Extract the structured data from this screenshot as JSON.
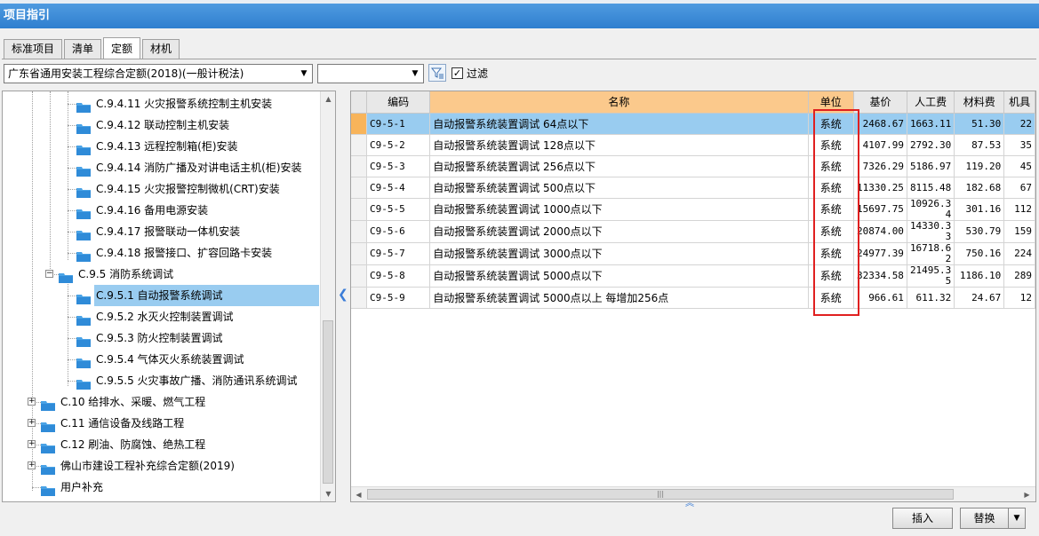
{
  "window": {
    "title": "项目指引"
  },
  "tabs": [
    {
      "label": "标准项目",
      "active": false
    },
    {
      "label": "清单",
      "active": false
    },
    {
      "label": "定额",
      "active": true
    },
    {
      "label": "材机",
      "active": false
    }
  ],
  "filter": {
    "quota_library": "广东省通用安装工程综合定额(2018)(一般计税法)",
    "secondary_combo": "",
    "filter_checked": true,
    "filter_label": "过滤"
  },
  "tree": {
    "items": [
      {
        "label": "C.9.4.11 火灾报警系统控制主机安装",
        "selected": false
      },
      {
        "label": "C.9.4.12 联动控制主机安装",
        "selected": false
      },
      {
        "label": "C.9.4.13 远程控制箱(柜)安装",
        "selected": false
      },
      {
        "label": "C.9.4.14 消防广播及对讲电话主机(柜)安装",
        "selected": false
      },
      {
        "label": "C.9.4.15 火灾报警控制微机(CRT)安装",
        "selected": false
      },
      {
        "label": "C.9.4.16 备用电源安装",
        "selected": false
      },
      {
        "label": "C.9.4.17 报警联动一体机安装",
        "selected": false
      },
      {
        "label": "C.9.4.18 报警接口、扩容回路卡安装",
        "selected": false
      },
      {
        "label": "C.9.5 消防系统调试",
        "selected": false,
        "expander": "−"
      },
      {
        "label": "C.9.5.1 自动报警系统调试",
        "selected": true
      },
      {
        "label": "C.9.5.2 水灭火控制装置调试",
        "selected": false
      },
      {
        "label": "C.9.5.3 防火控制装置调试",
        "selected": false
      },
      {
        "label": "C.9.5.4 气体灭火系统装置调试",
        "selected": false
      },
      {
        "label": "C.9.5.5 火灾事故广播、消防通讯系统调试",
        "selected": false
      },
      {
        "label": "C.10 给排水、采暖、燃气工程",
        "selected": false,
        "expander": "+"
      },
      {
        "label": "C.11 通信设备及线路工程",
        "selected": false,
        "expander": "+"
      },
      {
        "label": "C.12 刷油、防腐蚀、绝热工程",
        "selected": false,
        "expander": "+"
      },
      {
        "label": "佛山市建设工程补充综合定额(2019)",
        "selected": false,
        "expander": "+"
      },
      {
        "label": "用户补充",
        "selected": false
      }
    ]
  },
  "grid": {
    "columns": [
      "编码",
      "名称",
      "单位",
      "基价",
      "人工费",
      "材料费",
      "机具"
    ],
    "rows": [
      {
        "code": "C9-5-1",
        "name": "自动报警系统装置调试 64点以下",
        "unit": "系统",
        "base": "2468.67",
        "labor": "1663.11",
        "material": "51.30",
        "machine": "22",
        "selected": true
      },
      {
        "code": "C9-5-2",
        "name": "自动报警系统装置调试 128点以下",
        "unit": "系统",
        "base": "4107.99",
        "labor": "2792.30",
        "material": "87.53",
        "machine": "35",
        "selected": false
      },
      {
        "code": "C9-5-3",
        "name": "自动报警系统装置调试 256点以下",
        "unit": "系统",
        "base": "7326.29",
        "labor": "5186.97",
        "material": "119.20",
        "machine": "45",
        "selected": false
      },
      {
        "code": "C9-5-4",
        "name": "自动报警系统装置调试 500点以下",
        "unit": "系统",
        "base": "11330.25",
        "labor": "8115.48",
        "material": "182.68",
        "machine": "67",
        "selected": false
      },
      {
        "code": "C9-5-5",
        "name": "自动报警系统装置调试 1000点以下",
        "unit": "系统",
        "base": "15697.75",
        "labor": "10926.34",
        "material": "301.16",
        "machine": "112",
        "selected": false
      },
      {
        "code": "C9-5-6",
        "name": "自动报警系统装置调试 2000点以下",
        "unit": "系统",
        "base": "20874.00",
        "labor": "14330.33",
        "material": "530.79",
        "machine": "159",
        "selected": false
      },
      {
        "code": "C9-5-7",
        "name": "自动报警系统装置调试 3000点以下",
        "unit": "系统",
        "base": "24977.39",
        "labor": "16718.62",
        "material": "750.16",
        "machine": "224",
        "selected": false
      },
      {
        "code": "C9-5-8",
        "name": "自动报警系统装置调试 5000点以下",
        "unit": "系统",
        "base": "32334.58",
        "labor": "21495.35",
        "material": "1186.10",
        "machine": "289",
        "selected": false
      },
      {
        "code": "C9-5-9",
        "name": "自动报警系统装置调试 5000点以上 每增加256点",
        "unit": "系统",
        "base": "966.61",
        "labor": "611.32",
        "material": "24.67",
        "machine": "12",
        "selected": false
      }
    ]
  },
  "buttons": {
    "insert": "插入",
    "replace": "替换"
  },
  "colors": {
    "title_bar": "#3a8ad8",
    "selection": "#99ccf0",
    "header_highlight": "#fbc98c",
    "annotation_box": "#e02020"
  }
}
